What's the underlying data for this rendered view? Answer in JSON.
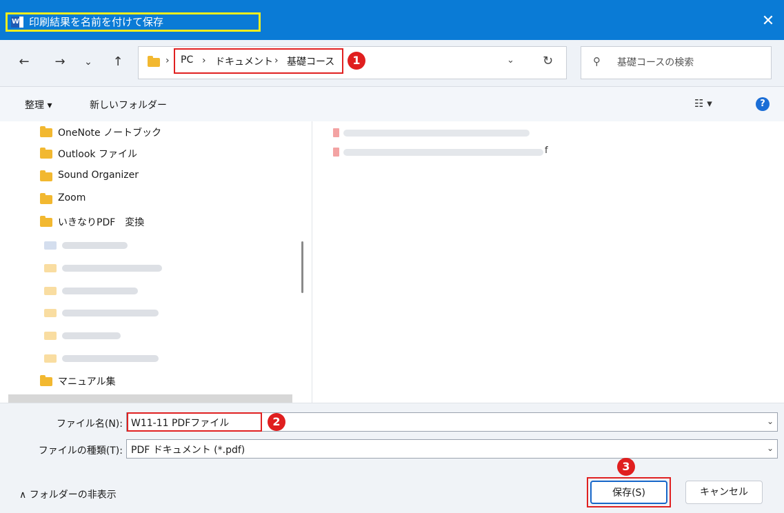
{
  "title_bar": {
    "app_icon_letter": "W",
    "title": "印刷結果を名前を付けて保存",
    "close_glyph": "✕"
  },
  "nav": {
    "back": "←",
    "forward": "→",
    "recent": "⌄",
    "up": "↑"
  },
  "address": {
    "sep": "›",
    "crumbs": [
      "PC",
      "ドキュメント",
      "基礎コース"
    ],
    "dropdown": "⌄",
    "refresh": "↻"
  },
  "search": {
    "icon": "⚲",
    "placeholder": "基礎コースの検索"
  },
  "toolbar": {
    "organize": "整理 ▾",
    "new_folder": "新しいフォルダー",
    "view": "☷ ▾",
    "help": "?"
  },
  "tree": [
    {
      "label": "OneNote ノートブック"
    },
    {
      "label": "Outlook ファイル"
    },
    {
      "label": "Sound Organizer"
    },
    {
      "label": "Zoom"
    },
    {
      "label": "いきなりPDF　変換"
    },
    {
      "label": "マニュアル集"
    }
  ],
  "files": [
    {
      "suffix": ""
    },
    {
      "suffix": "f"
    }
  ],
  "form": {
    "file_name_label": "ファイル名(N):",
    "file_name_value": "W11-11 PDFファイル",
    "file_type_label": "ファイルの種類(T):",
    "file_type_value": "PDF ドキュメント (*.pdf)",
    "dropdown": "⌄"
  },
  "footer": {
    "hide_folders": "∧  フォルダーの非表示",
    "save": "保存(S)",
    "cancel": "キャンセル"
  },
  "badges": [
    "1",
    "2",
    "3"
  ],
  "colors": {
    "title_bar": "#0a7bd6",
    "highlight_red": "#e02020",
    "highlight_yellow": "#f3ee1c",
    "folder": "#f2b830"
  }
}
